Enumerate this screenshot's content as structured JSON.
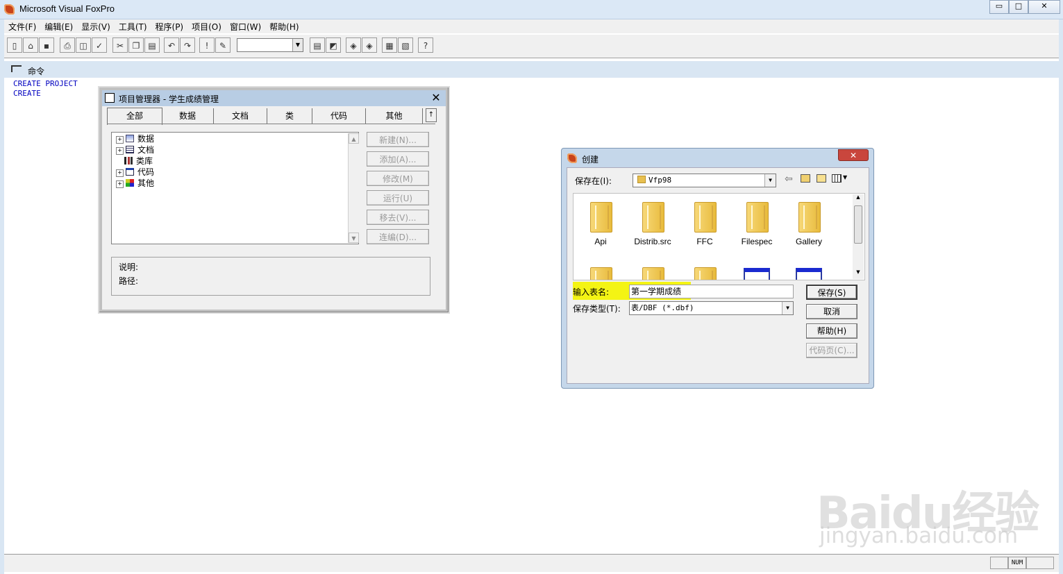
{
  "app": {
    "title": "Microsoft Visual FoxPro",
    "window_controls": {
      "minimize": "▭",
      "maximize": "□",
      "close": "✕"
    }
  },
  "menu": [
    {
      "label": "文件(F)"
    },
    {
      "label": "编辑(E)"
    },
    {
      "label": "显示(V)"
    },
    {
      "label": "工具(T)"
    },
    {
      "label": "程序(P)"
    },
    {
      "label": "项目(O)"
    },
    {
      "label": "窗口(W)"
    },
    {
      "label": "帮助(H)"
    }
  ],
  "toolbar": {
    "combo_value": "",
    "help_glyph": "?",
    "run_glyph": "!"
  },
  "command_window": {
    "title": "命令",
    "lines": [
      "CREATE PROJECT",
      "CREATE"
    ]
  },
  "project_manager": {
    "title": "项目管理器 - 学生成绩管理",
    "close_glyph": "✕",
    "tabs": [
      {
        "label": "全部"
      },
      {
        "label": "数据"
      },
      {
        "label": "文档"
      },
      {
        "label": "类"
      },
      {
        "label": "代码"
      },
      {
        "label": "其他"
      }
    ],
    "tab_toggle": "↑",
    "tree": [
      {
        "label": "数据",
        "expander": "+",
        "icon": "database-icon"
      },
      {
        "label": "文档",
        "expander": "+",
        "icon": "document-icon"
      },
      {
        "label": "类库",
        "expander": "",
        "icon": "class-library-icon"
      },
      {
        "label": "代码",
        "expander": "+",
        "icon": "code-icon"
      },
      {
        "label": "其他",
        "expander": "+",
        "icon": "other-icon"
      }
    ],
    "buttons": [
      {
        "label": "新建(N)..."
      },
      {
        "label": "添加(A)..."
      },
      {
        "label": "修改(M)"
      },
      {
        "label": "运行(U)"
      },
      {
        "label": "移去(V)..."
      },
      {
        "label": "连编(D)..."
      }
    ],
    "description_label": "说明:",
    "path_label": "路径:"
  },
  "create_dialog": {
    "title": "创建",
    "close_glyph": "✕",
    "save_in_label": "保存在(I):",
    "save_in_value": "Vfp98",
    "folders": [
      {
        "name": "Api"
      },
      {
        "name": "Distrib.src"
      },
      {
        "name": "FFC"
      },
      {
        "name": "Filespec"
      },
      {
        "name": "Gallery"
      }
    ],
    "name_label": "输入表名:",
    "name_value": "第一学期成绩",
    "type_label": "保存类型(T):",
    "type_value": "表/DBF (*.dbf)",
    "buttons": {
      "save": "保存(S)",
      "cancel": "取消",
      "help": "帮助(H)",
      "codepage": "代码页(C)..."
    }
  },
  "status": {
    "num": "NUM"
  },
  "watermark": {
    "line1": "Baidu经验",
    "line2": "jingyan.baidu.com"
  },
  "colors": {
    "highlight": "#f4f414",
    "command_text": "#0000c0",
    "titlebar": "#dbe8f6"
  }
}
